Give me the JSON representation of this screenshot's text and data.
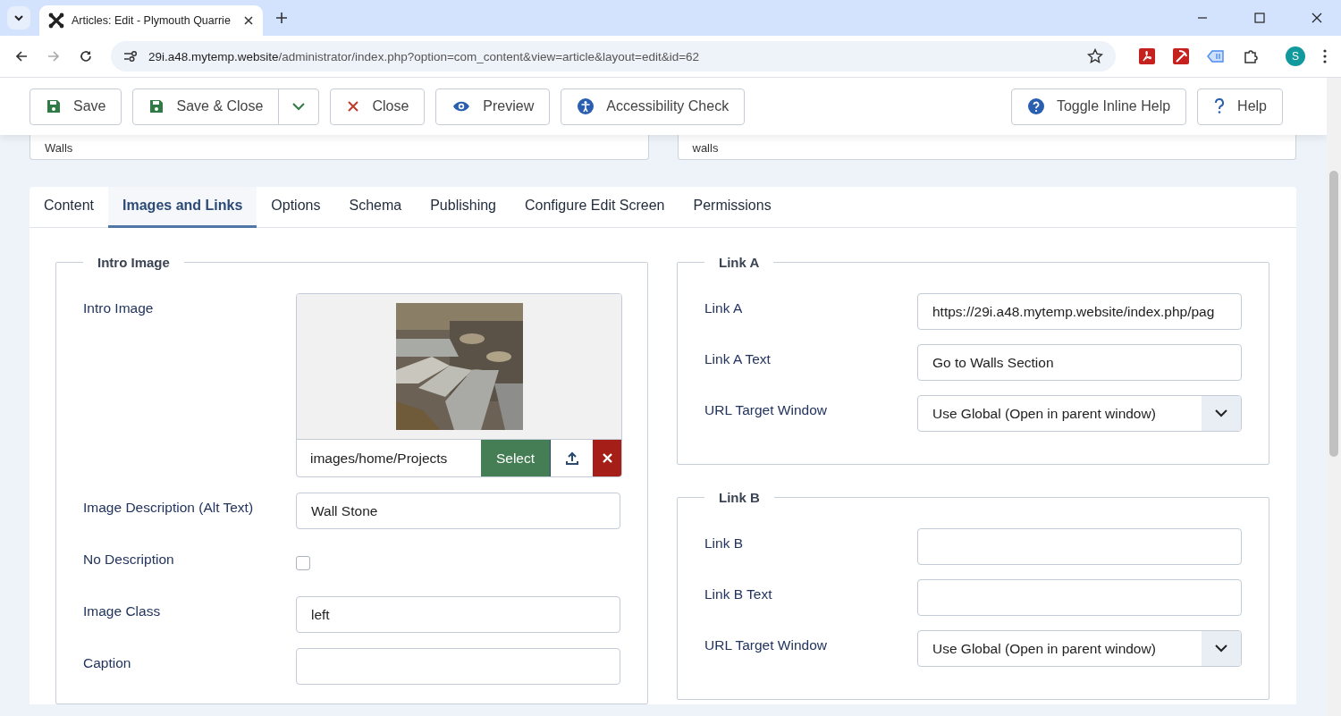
{
  "browser": {
    "tab_title": "Articles: Edit - Plymouth Quarrie",
    "url_host": "29i.a48.mytemp.website",
    "url_path": "/administrator/index.php?option=com_content&view=article&layout=edit&id=62",
    "avatar": "S"
  },
  "toolbar": {
    "buttons": [
      {
        "label": "Save",
        "kind": "save"
      },
      {
        "label": "Save & Close",
        "kind": "save-split"
      },
      {
        "label": "Close",
        "kind": "close"
      },
      {
        "label": "Preview",
        "kind": "preview"
      },
      {
        "label": "Accessibility Check",
        "kind": "accessibility"
      }
    ],
    "right_buttons": [
      {
        "label": "Toggle Inline Help",
        "kind": "help-circle"
      },
      {
        "label": "Help",
        "kind": "question"
      }
    ]
  },
  "title_fields": [
    {
      "value": "Walls"
    },
    {
      "value": "walls"
    }
  ],
  "tabs": [
    {
      "label": "Content",
      "selected": false
    },
    {
      "label": "Images and Links",
      "selected": true
    },
    {
      "label": "Options",
      "selected": false
    },
    {
      "label": "Schema",
      "selected": false
    },
    {
      "label": "Publishing",
      "selected": false
    },
    {
      "label": "Configure Edit Screen",
      "selected": false
    },
    {
      "label": "Permissions",
      "selected": false
    }
  ],
  "intro_image": {
    "legend": "Intro Image",
    "fields": [
      {
        "label": "Intro Image",
        "value": "images/home/Projects",
        "select": "Select"
      },
      {
        "kind": "text",
        "label": "Image Description (Alt Text)",
        "value": "Wall Stone"
      },
      {
        "kind": "checkbox",
        "label": "No Description",
        "checked": false
      },
      {
        "kind": "text",
        "label": "Image Class",
        "value": "left"
      },
      {
        "kind": "text",
        "label": "Caption"
      }
    ]
  },
  "links": [
    {
      "legend": "Link A",
      "fields": [
        {
          "kind": "text",
          "label": "Link A",
          "value": "https://29i.a48.mytemp.website/index.php/pag"
        },
        {
          "kind": "text",
          "label": "Link A Text",
          "value": "Go to Walls Section"
        },
        {
          "kind": "select",
          "label": "URL Target Window",
          "value": "Use Global (Open in parent window)"
        }
      ]
    },
    {
      "legend": "Link B",
      "fields": [
        {
          "kind": "text",
          "label": "Link B"
        },
        {
          "kind": "text",
          "label": "Link B Text"
        },
        {
          "kind": "select",
          "label": "URL Target Window",
          "value": "Use Global (Open in parent window)"
        }
      ]
    }
  ]
}
